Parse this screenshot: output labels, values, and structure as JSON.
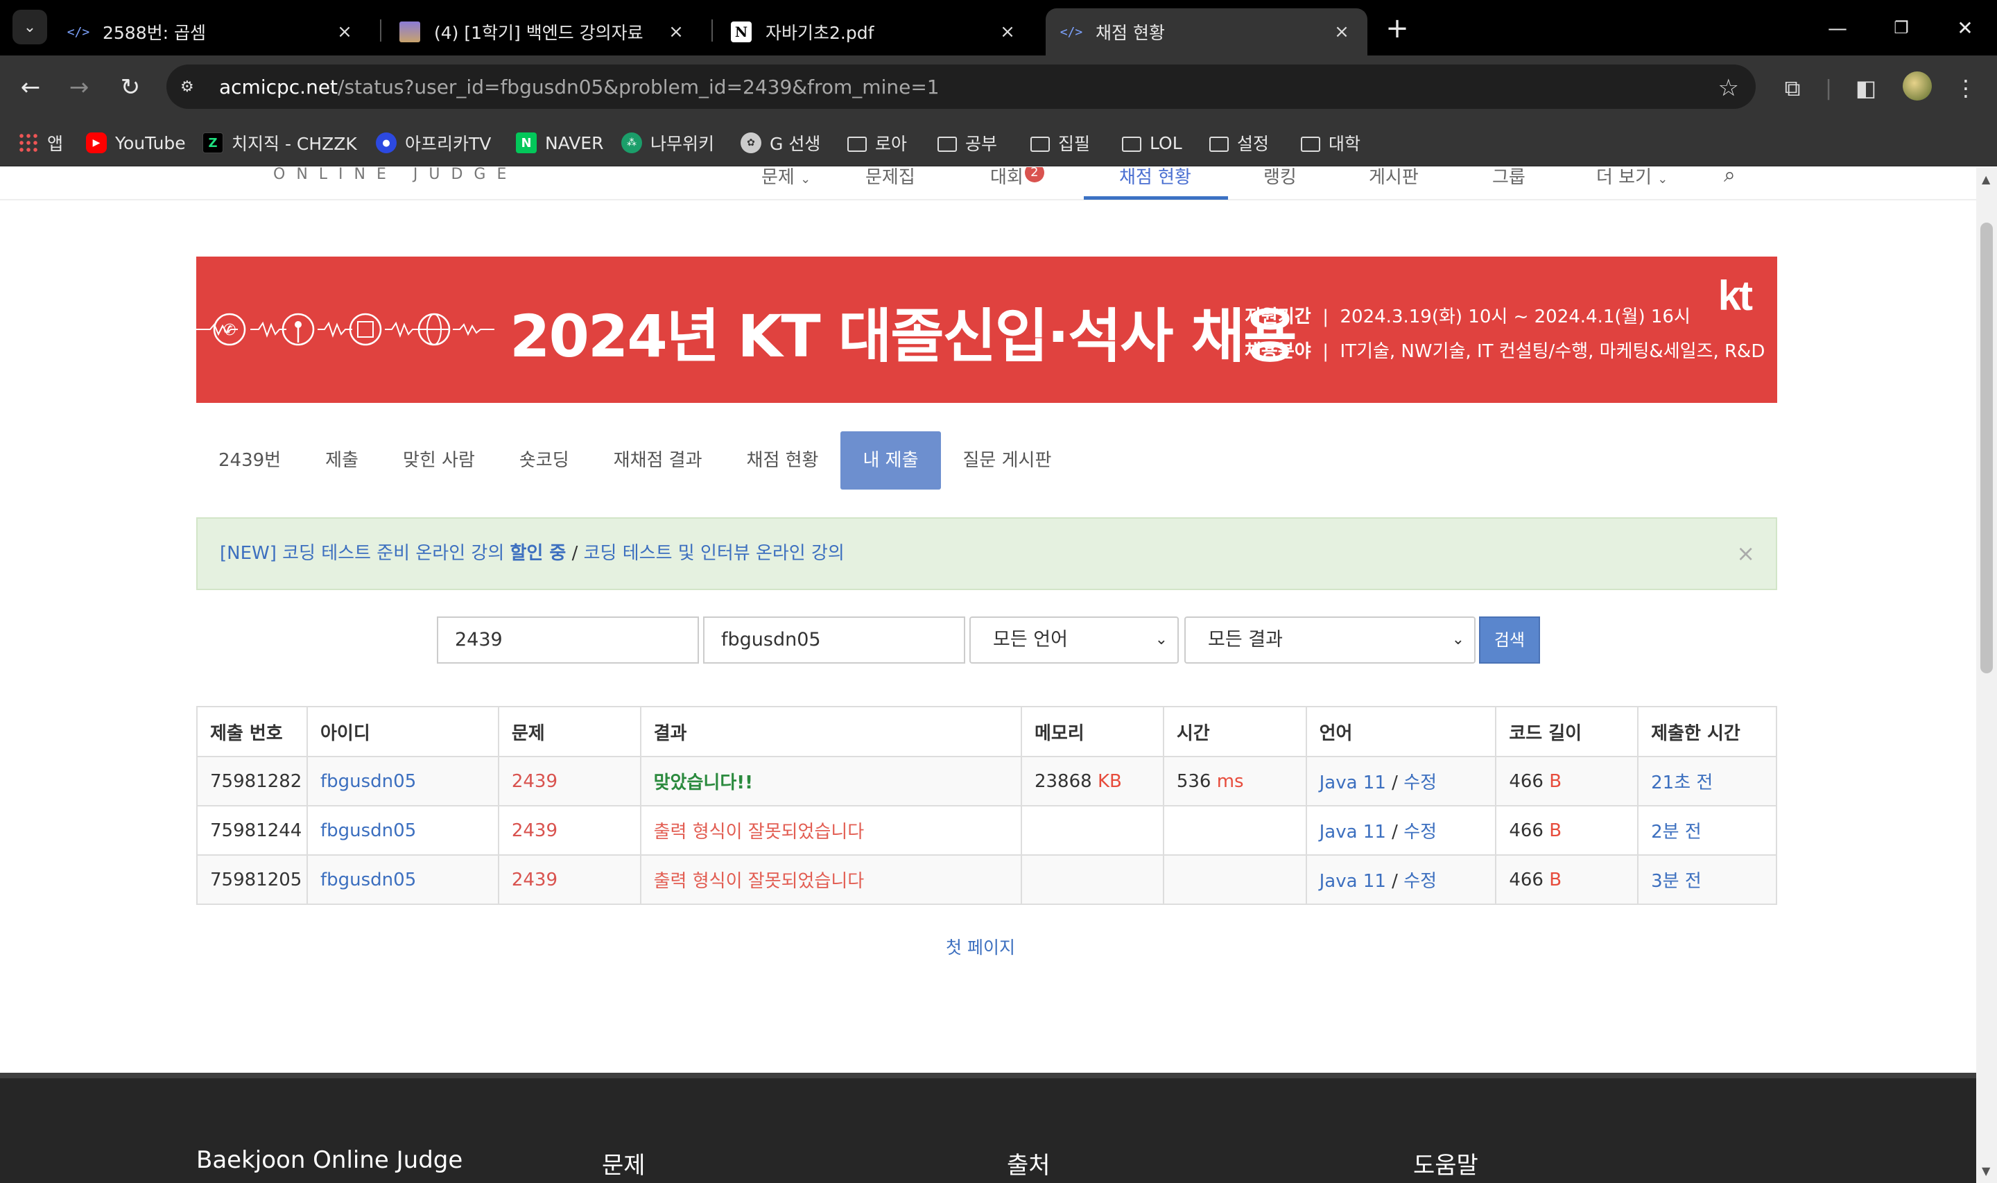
{
  "browser": {
    "tabs": [
      {
        "title": "2588번: 곱셈",
        "icon": "code-icon",
        "active": false
      },
      {
        "title": "(4) [1학기] 백엔드 강의자료",
        "icon": "book-icon",
        "active": false
      },
      {
        "title": "자바기초2.pdf",
        "icon": "notion-icon",
        "active": false
      },
      {
        "title": "채점 현황",
        "icon": "code-icon",
        "active": true
      }
    ],
    "url_host": "acmicpc.net",
    "url_path": "/status?user_id=fbgusdn05&problem_id=2439&from_mine=1",
    "bookmarks": [
      {
        "label": "앱",
        "icon": "apps-icon"
      },
      {
        "label": "YouTube",
        "icon": "youtube-icon"
      },
      {
        "label": "치지직 - CHZZK",
        "icon": "chzzk-icon"
      },
      {
        "label": "아프리카TV",
        "icon": "afreeca-icon"
      },
      {
        "label": "NAVER",
        "icon": "naver-icon"
      },
      {
        "label": "나무위키",
        "icon": "namuwiki-icon"
      },
      {
        "label": "G 선생",
        "icon": "gpt-icon"
      },
      {
        "label": "로아",
        "icon": "folder-icon"
      },
      {
        "label": "공부",
        "icon": "folder-icon"
      },
      {
        "label": "집필",
        "icon": "folder-icon"
      },
      {
        "label": "LOL",
        "icon": "folder-icon"
      },
      {
        "label": "설정",
        "icon": "folder-icon"
      },
      {
        "label": "대학",
        "icon": "folder-icon"
      }
    ]
  },
  "site": {
    "logo_sub": "ONLINE JUDGE",
    "menu": [
      {
        "label": "문제",
        "dropdown": true
      },
      {
        "label": "문제집"
      },
      {
        "label": "대회",
        "badge": "2"
      },
      {
        "label": "채점 현황",
        "active": true
      },
      {
        "label": "랭킹"
      },
      {
        "label": "게시판"
      },
      {
        "label": "그룹"
      },
      {
        "label": "더 보기",
        "dropdown": true
      }
    ]
  },
  "banner": {
    "headline": "2024년 KT 대졸신입·석사 채용",
    "period_label": "지원기간",
    "period_value": "2024.3.19(화) 10시 ~ 2024.4.1(월) 16시",
    "field_label": "채용분야",
    "field_value": "IT기술, NW기술, IT 컨설팅/수행, 마케팅&세일즈, R&D",
    "brand": "kt",
    "color": "#e0423f"
  },
  "problem_tabs": [
    "2439번",
    "제출",
    "맞힌 사람",
    "숏코딩",
    "재채점 결과",
    "채점 현황",
    "내 제출",
    "질문 게시판"
  ],
  "alert": {
    "part1": "[NEW] 코딩 테스트 준비 온라인 강의 ",
    "part1_bold": "할인 중",
    "separator": " / ",
    "part2": "코딩 테스트 및 인터뷰 온라인 강의",
    "close": "×"
  },
  "search": {
    "problem_id": "2439",
    "user_id": "fbgusdn05",
    "language": "모든 언어",
    "result": "모든 결과",
    "button": "검색"
  },
  "table": {
    "headers": [
      "제출 번호",
      "아이디",
      "문제",
      "결과",
      "메모리",
      "시간",
      "언어",
      "코드 길이",
      "제출한 시간"
    ],
    "rows": [
      {
        "id": "75981282",
        "user": "fbgusdn05",
        "problem": "2439",
        "result": "맞았습니다!!",
        "result_type": "ac",
        "memory": "23868",
        "memory_unit": "KB",
        "time": "536",
        "time_unit": "ms",
        "lang": "Java 11",
        "edit": "수정",
        "length": "466",
        "length_unit": "B",
        "submitted": "21초 전"
      },
      {
        "id": "75981244",
        "user": "fbgusdn05",
        "problem": "2439",
        "result": "출력 형식이 잘못되었습니다",
        "result_type": "pe",
        "memory": "",
        "memory_unit": "",
        "time": "",
        "time_unit": "",
        "lang": "Java 11",
        "edit": "수정",
        "length": "466",
        "length_unit": "B",
        "submitted": "2분 전"
      },
      {
        "id": "75981205",
        "user": "fbgusdn05",
        "problem": "2439",
        "result": "출력 형식이 잘못되었습니다",
        "result_type": "pe",
        "memory": "",
        "memory_unit": "",
        "time": "",
        "time_unit": "",
        "lang": "Java 11",
        "edit": "수정",
        "length": "466",
        "length_unit": "B",
        "submitted": "3분 전"
      }
    ]
  },
  "pagination": {
    "first": "첫 페이지"
  },
  "footer": {
    "columns": [
      "Baekjoon Online Judge",
      "문제",
      "출처",
      "도움말"
    ]
  }
}
